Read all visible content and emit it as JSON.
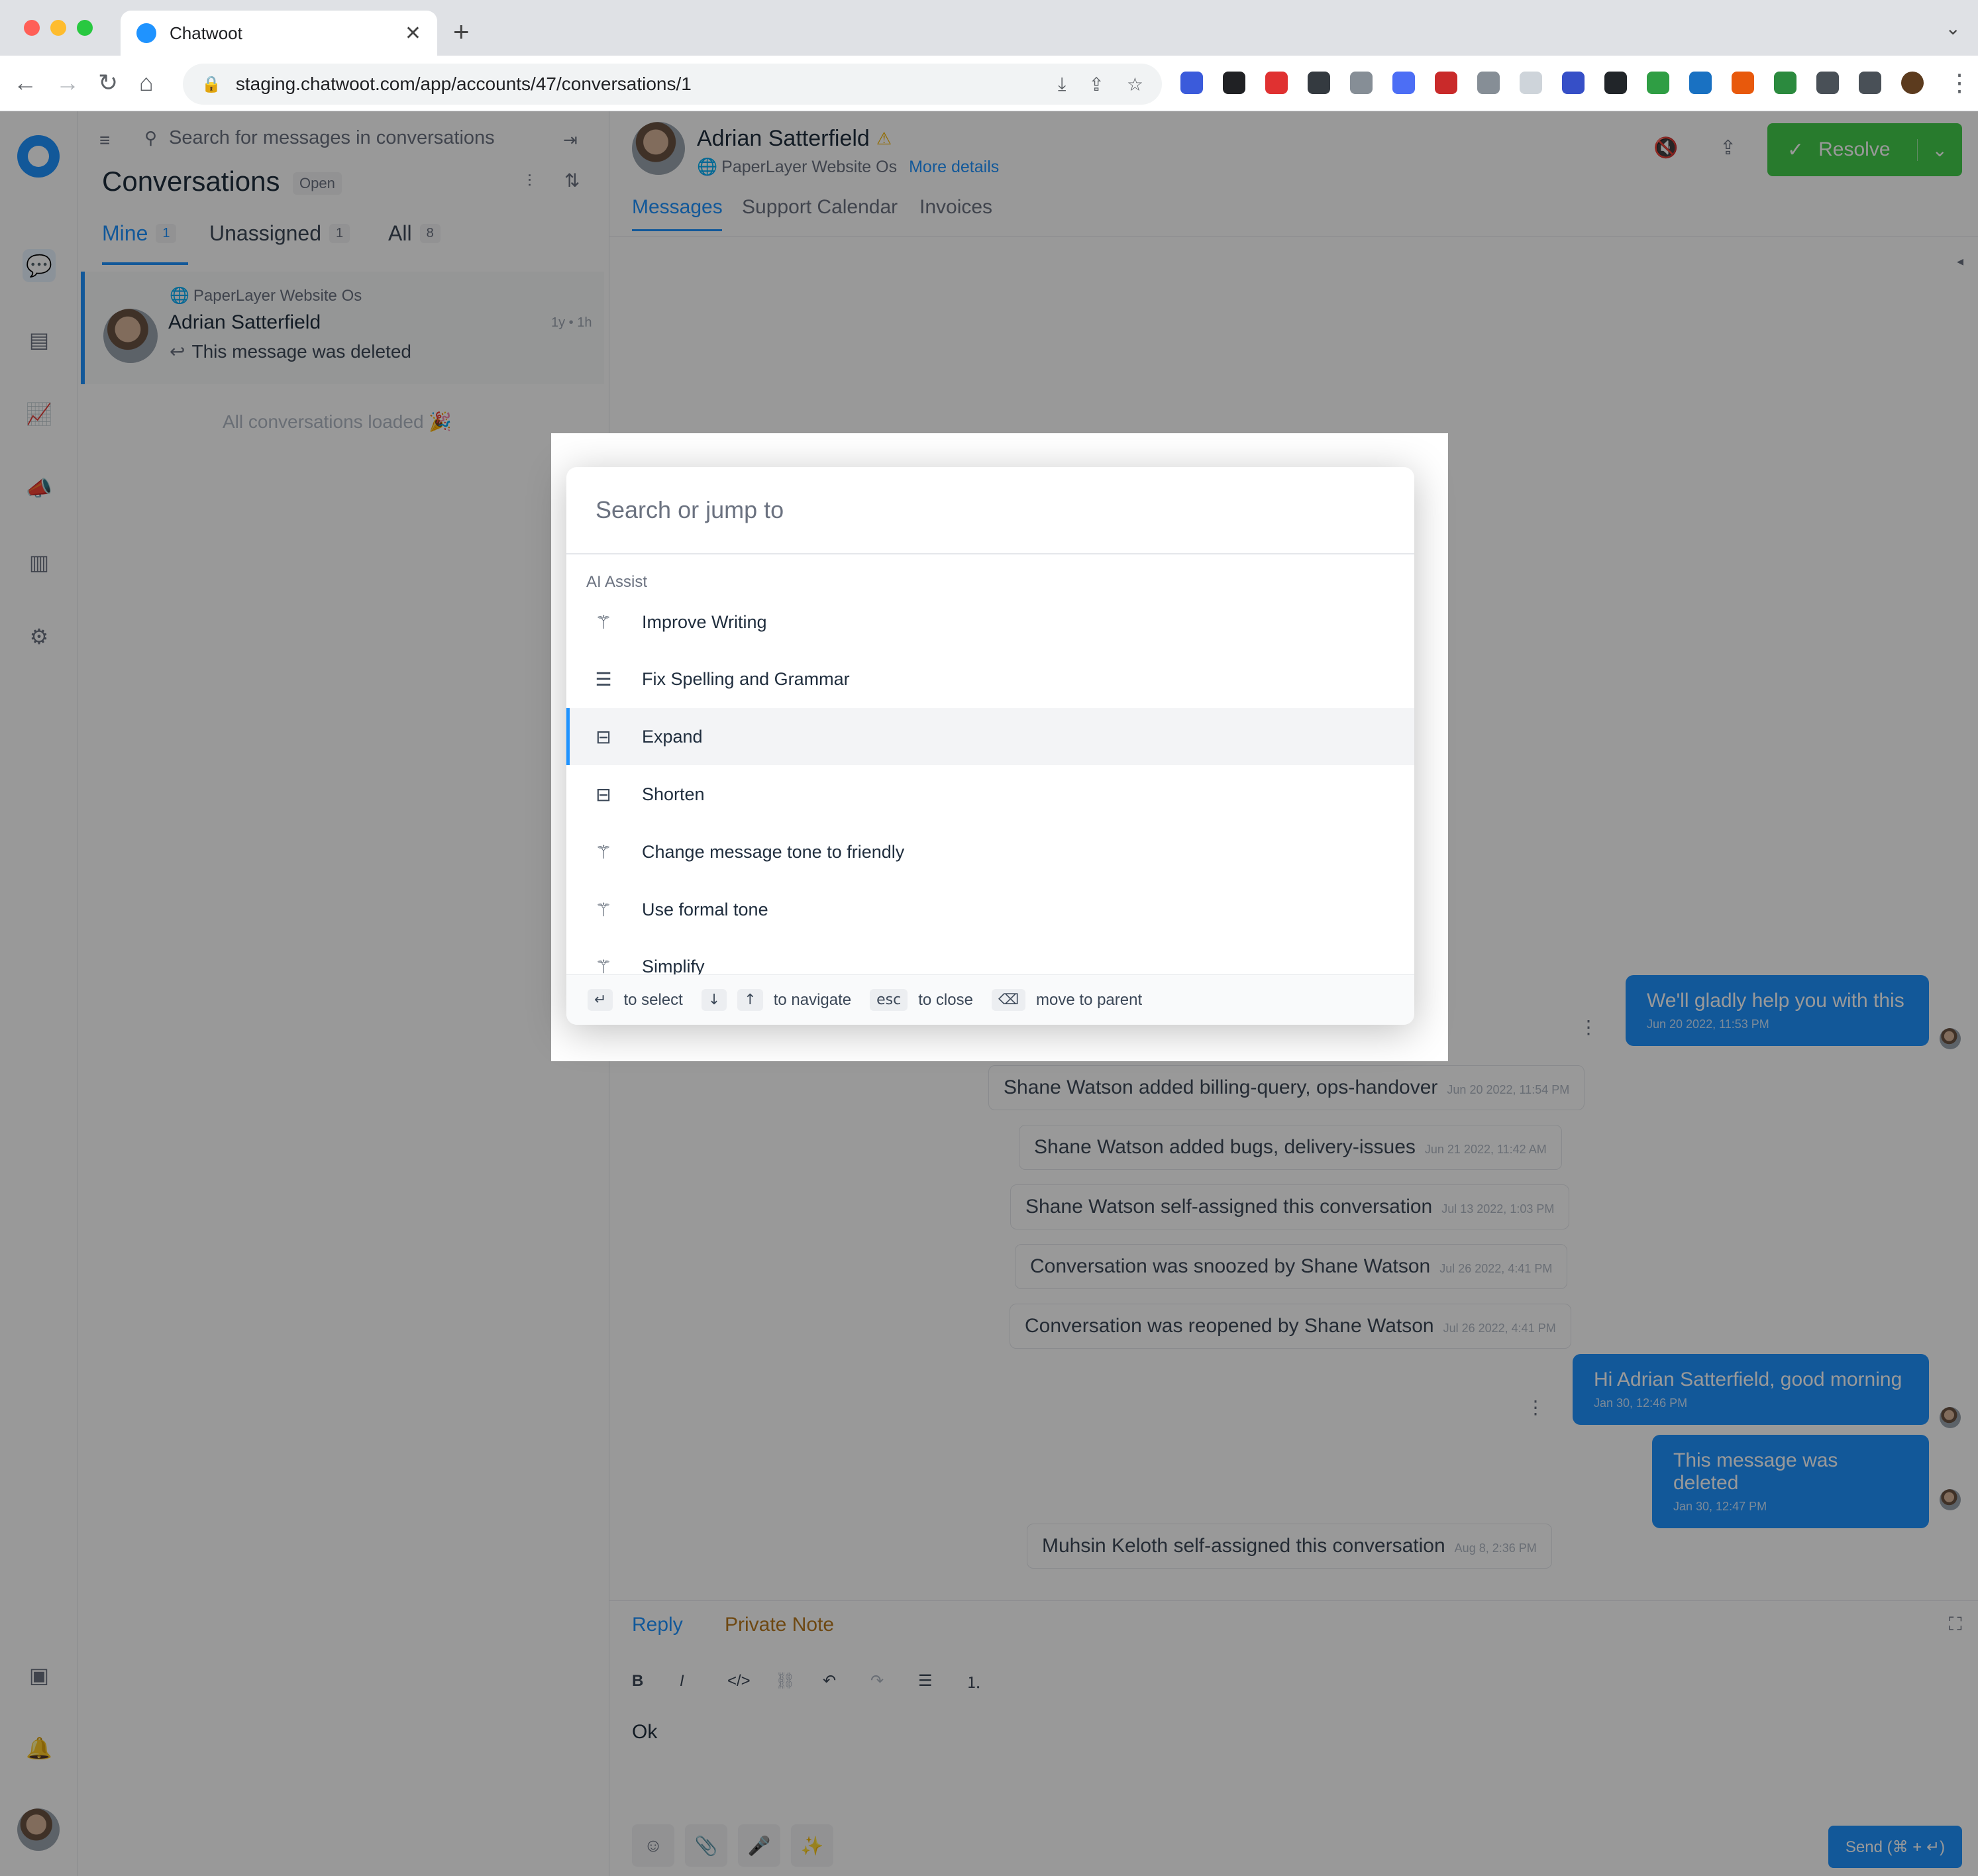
{
  "browser": {
    "tab_title": "Chatwoot",
    "tab_close": "✕",
    "new_tab": "+",
    "url": "staging.chatwoot.com/app/accounts/47/conversations/1"
  },
  "conversations": {
    "search_placeholder": "Search for messages in conversations",
    "title": "Conversations",
    "status_badge": "Open",
    "tabs": [
      {
        "label": "Mine",
        "count": "1"
      },
      {
        "label": "Unassigned",
        "count": "1"
      },
      {
        "label": "All",
        "count": "8"
      }
    ],
    "item": {
      "inbox": "PaperLayer Website Os",
      "name": "Adrian Satterfield",
      "time": "1y • 1h",
      "preview": "This message was deleted"
    },
    "loaded_text": "All conversations loaded 🎉"
  },
  "header": {
    "contact_name": "Adrian Satterfield",
    "inbox": "PaperLayer Website Os",
    "more_details": "More details",
    "resolve_label": "Resolve",
    "tabs": [
      "Messages",
      "Support Calendar",
      "Invoices"
    ]
  },
  "messages": {
    "outgoing": [
      {
        "text": "We'll gladly help you with this",
        "time": "Jun 20 2022, 11:53 PM"
      },
      {
        "text": "Hi Adrian Satterfield, good morning",
        "time": "Jan 30, 12:46 PM"
      },
      {
        "text": "This message was deleted",
        "time": "Jan 30, 12:47 PM"
      }
    ],
    "activities": [
      {
        "text": "Shane Watson added billing-query, ops-handover",
        "time": "Jun 20 2022, 11:54 PM"
      },
      {
        "text": "Shane Watson added bugs, delivery-issues",
        "time": "Jun 21 2022, 11:42 AM"
      },
      {
        "text": "Shane Watson self-assigned this conversation",
        "time": "Jul 13 2022, 1:03 PM"
      },
      {
        "text": "Conversation was snoozed by Shane Watson",
        "time": "Jul 26 2022, 4:41 PM"
      },
      {
        "text": "Conversation was reopened by Shane Watson",
        "time": "Jul 26 2022, 4:41 PM"
      },
      {
        "text": "Muhsin Keloth self-assigned this conversation",
        "time": "Aug 8, 2:36 PM"
      }
    ]
  },
  "reply": {
    "tab_reply": "Reply",
    "tab_private": "Private Note",
    "draft": "Ok",
    "send_label": "Send (⌘ + ↵)"
  },
  "palette": {
    "search_placeholder": "Search or jump to",
    "section": "AI Assist",
    "items": [
      {
        "label": "Improve Writing",
        "icon": "magic-wand-icon"
      },
      {
        "label": "Fix Spelling and Grammar",
        "icon": "text-check-icon"
      },
      {
        "label": "Expand",
        "icon": "expand-text-icon"
      },
      {
        "label": "Shorten",
        "icon": "shorten-text-icon"
      },
      {
        "label": "Change message tone to friendly",
        "icon": "magic-wand-icon"
      },
      {
        "label": "Use formal tone",
        "icon": "magic-wand-icon"
      },
      {
        "label": "Simplify",
        "icon": "magic-wand-icon"
      }
    ],
    "active_index": 2,
    "footer": {
      "select": "to select",
      "navigate": "to navigate",
      "esc_key": "esc",
      "close": "to close",
      "parent": "move to parent"
    }
  },
  "colors": {
    "accent": "#1f93ff",
    "resolve": "#44ce4b"
  }
}
